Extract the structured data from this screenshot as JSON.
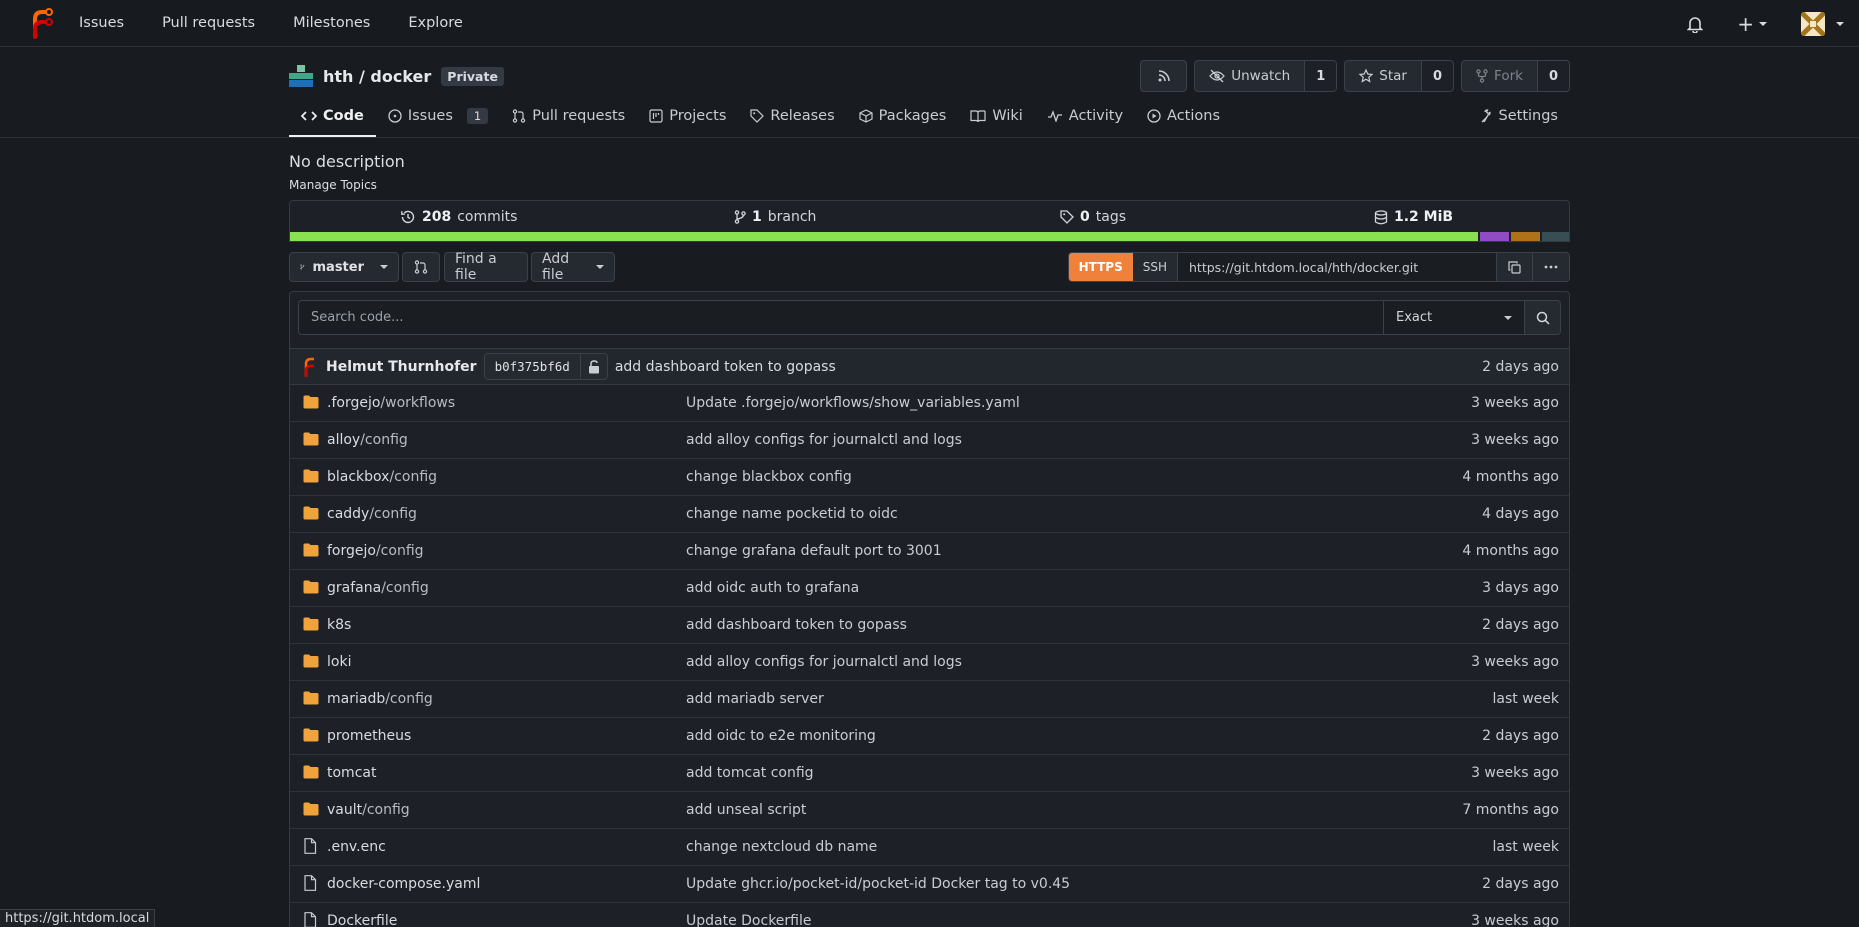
{
  "topnav": {
    "links": [
      "Issues",
      "Pull requests",
      "Milestones",
      "Explore"
    ],
    "plus": "+"
  },
  "repo": {
    "title": "hth / docker",
    "visibility": "Private",
    "watch_label": "Unwatch",
    "watch_count": "1",
    "star_label": "Star",
    "star_count": "0",
    "fork_label": "Fork",
    "fork_count": "0"
  },
  "tabs": {
    "code": "Code",
    "issues": "Issues",
    "issues_count": "1",
    "pulls": "Pull requests",
    "projects": "Projects",
    "releases": "Releases",
    "packages": "Packages",
    "wiki": "Wiki",
    "activity": "Activity",
    "actions": "Actions",
    "settings": "Settings"
  },
  "description": "No description",
  "manage_topics": "Manage Topics",
  "stats": {
    "commits_num": "208",
    "commits_label": "commits",
    "branch_num": "1",
    "branch_label": "branch",
    "tags_num": "0",
    "tags_label": "tags",
    "size": "1.2 MiB"
  },
  "language_bar_colors": [
    "#89e051",
    "#8f4cc4",
    "#b07219",
    "#384d54"
  ],
  "language_bar_fractions": [
    0.929,
    0.024,
    0.024,
    0.023
  ],
  "toolbar": {
    "branch": "master",
    "find_file": "Find a file",
    "add_file": "Add file",
    "https": "HTTPS",
    "ssh": "SSH",
    "clone_url": "https://git.htdom.local/hth/docker.git"
  },
  "search": {
    "placeholder": "Search code...",
    "mode": "Exact"
  },
  "latest_commit": {
    "author": "Helmut Thurnhofer",
    "sha": "b0f375bf6d",
    "message": "add dashboard token to gopass",
    "time": "2 days ago"
  },
  "files": [
    {
      "type": "dir",
      "name": ".forgejo",
      "sub": "/workflows",
      "commit": "Update .forgejo/workflows/show_variables.yaml",
      "time": "3 weeks ago"
    },
    {
      "type": "dir",
      "name": "alloy",
      "sub": "/config",
      "commit": "add alloy configs for journalctl and logs",
      "time": "3 weeks ago"
    },
    {
      "type": "dir",
      "name": "blackbox",
      "sub": "/config",
      "commit": "change blackbox config",
      "time": "4 months ago"
    },
    {
      "type": "dir",
      "name": "caddy",
      "sub": "/config",
      "commit": "change name pocketid to oidc",
      "time": "4 days ago"
    },
    {
      "type": "dir",
      "name": "forgejo",
      "sub": "/config",
      "commit": "change grafana default port to 3001",
      "time": "4 months ago"
    },
    {
      "type": "dir",
      "name": "grafana",
      "sub": "/config",
      "commit": "add oidc auth to grafana",
      "time": "3 days ago"
    },
    {
      "type": "dir",
      "name": "k8s",
      "sub": "",
      "commit": "add dashboard token to gopass",
      "time": "2 days ago"
    },
    {
      "type": "dir",
      "name": "loki",
      "sub": "",
      "commit": "add alloy configs for journalctl and logs",
      "time": "3 weeks ago"
    },
    {
      "type": "dir",
      "name": "mariadb",
      "sub": "/config",
      "commit": "add mariadb server",
      "time": "last week"
    },
    {
      "type": "dir",
      "name": "prometheus",
      "sub": "",
      "commit": "add oidc to e2e monitoring",
      "time": "2 days ago"
    },
    {
      "type": "dir",
      "name": "tomcat",
      "sub": "",
      "commit": "add tomcat config",
      "time": "3 weeks ago"
    },
    {
      "type": "dir",
      "name": "vault",
      "sub": "/config",
      "commit": "add unseal script",
      "time": "7 months ago"
    },
    {
      "type": "file",
      "name": ".env.enc",
      "sub": "",
      "commit": "change nextcloud db name",
      "time": "last week"
    },
    {
      "type": "file",
      "name": "docker-compose.yaml",
      "sub": "",
      "commit": "Update ghcr.io/pocket-id/pocket-id Docker tag to v0.45",
      "time": "2 days ago"
    },
    {
      "type": "file",
      "name": "Dockerfile",
      "sub": "",
      "commit": "Update Dockerfile",
      "time": "3 weeks ago"
    }
  ],
  "status_url": "https://git.htdom.local"
}
